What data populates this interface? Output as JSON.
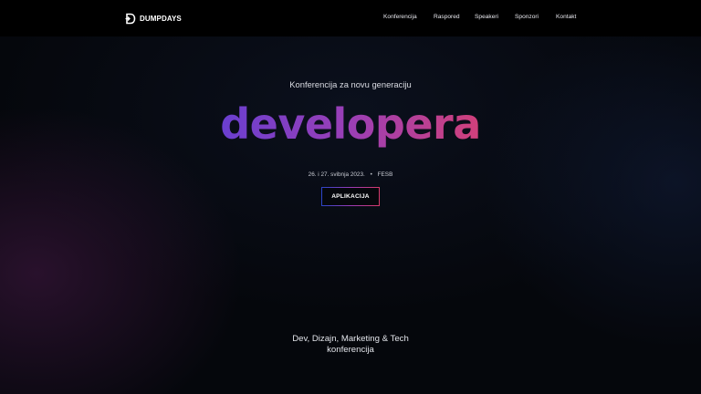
{
  "header": {
    "logo_text": "DUMPDAYS",
    "logo_icon": "dumpdays-logo-icon",
    "nav": [
      {
        "label": "Konferencija"
      },
      {
        "label": "Raspored"
      },
      {
        "label": "Speakeri"
      },
      {
        "label": "Sponzori"
      },
      {
        "label": "Kontakt"
      }
    ]
  },
  "hero": {
    "subtitle": "Konferencija za novu generaciju",
    "headline": "developera",
    "date": "26. i 27. svibnja 2023.",
    "separator": "•",
    "venue": "FESB",
    "cta_label": "APLIKACIJA"
  },
  "footer_tagline": {
    "line1": "Dev, Dizajn, Marketing & Tech",
    "line2": "konferencija"
  },
  "colors": {
    "background": "#05070c",
    "topbar": "#000000",
    "gradient_start": "#6a3fd0",
    "gradient_end": "#d1407a"
  }
}
